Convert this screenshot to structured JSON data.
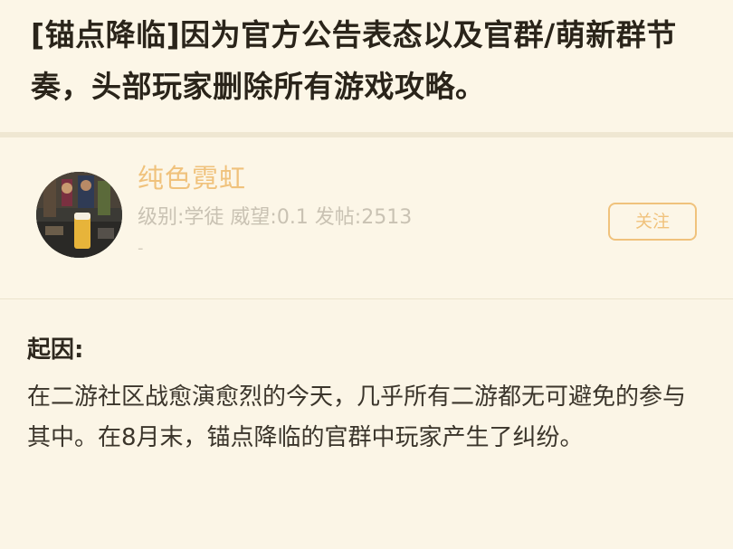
{
  "post": {
    "title": "[锚点降临]因为官方公告表态以及官群/萌新群节奏，头部玩家删除所有游戏攻略。"
  },
  "author": {
    "username": "纯色霓虹",
    "stats": "级别:学徒 威望:0.1 发帖:2513",
    "extra": "-",
    "follow_label": "关注"
  },
  "body": {
    "heading": "起因:",
    "paragraph": "在二游社区战愈演愈烈的今天，几乎所有二游都无可避免的参与其中。在8月末，锚点降临的官群中玩家产生了纠纷。"
  },
  "colors": {
    "background": "#fbf5e6",
    "accent": "#f0c27c",
    "muted_text": "#c9c2b3"
  }
}
